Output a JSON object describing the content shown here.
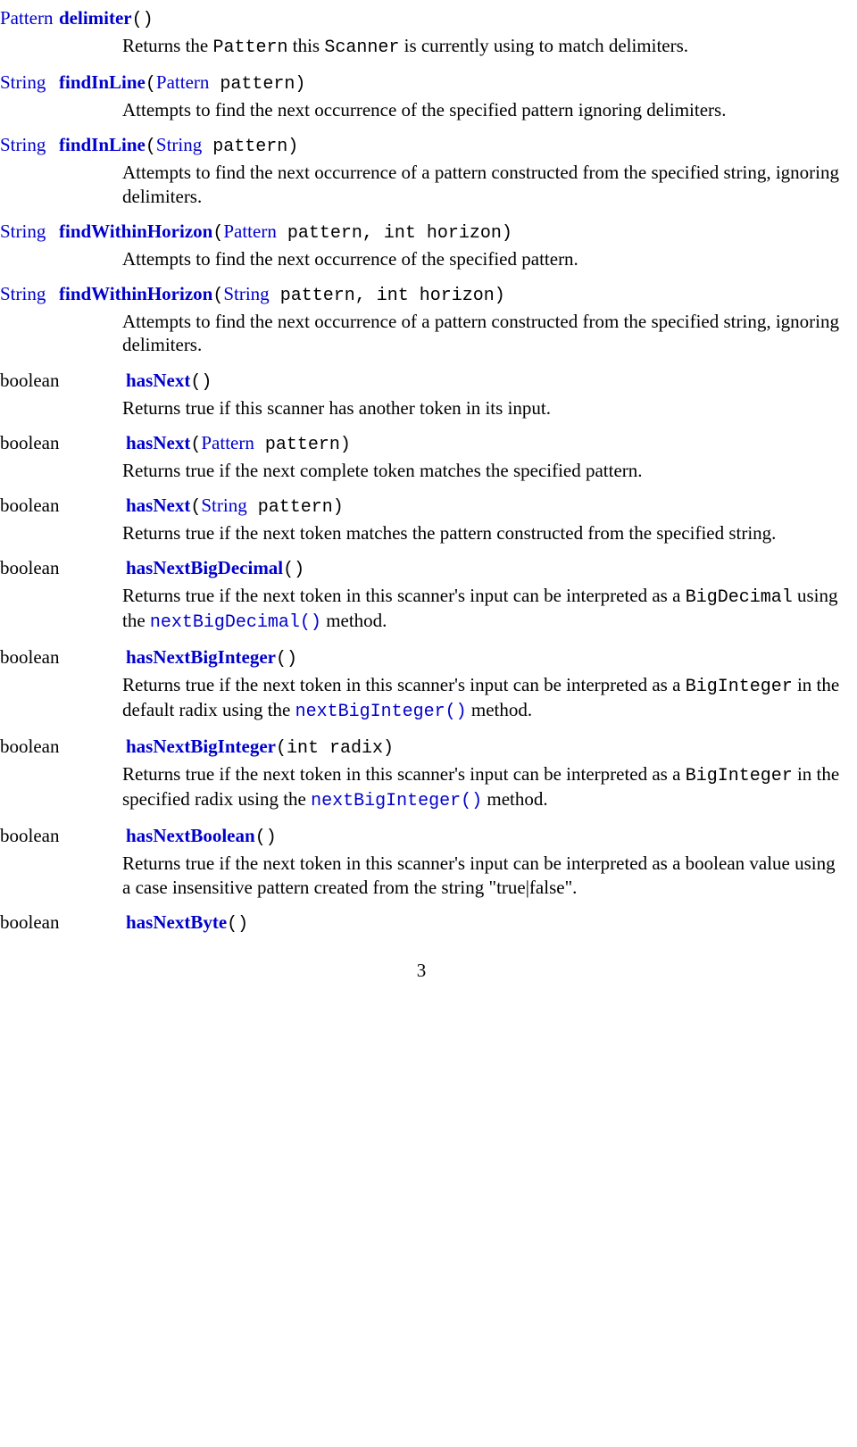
{
  "methods": [
    {
      "ret": "Pattern",
      "retLink": true,
      "retWide": false,
      "name": "delimiter",
      "paramsPlain": "()",
      "desc_pre": "Returns the ",
      "desc_code1": "Pattern",
      "desc_mid1": " this ",
      "desc_code2": "Scanner",
      "desc_post": " is currently using to match delimiters."
    },
    {
      "ret": "String",
      "retLink": true,
      "retWide": false,
      "name": "findInLine",
      "paramsPre": "(",
      "paramLink1": "Pattern",
      "paramsPost": " pattern)",
      "desc_pre": "Attempts to find the next occurrence of the specified pattern ignoring delimiters."
    },
    {
      "ret": "String",
      "retLink": true,
      "retWide": false,
      "name": "findInLine",
      "paramsPre": "(",
      "paramLink1": "String",
      "paramsPost": " pattern)",
      "desc_pre": "Attempts to find the next occurrence of a pattern constructed from the specified string, ignoring delimiters."
    },
    {
      "ret": "String",
      "retLink": true,
      "retWide": false,
      "name": "findWithinHorizon",
      "paramsPre": "(",
      "paramLink1": "Pattern",
      "paramsPost": " pattern, int horizon)",
      "desc_pre": "Attempts to find the next occurrence of the specified pattern."
    },
    {
      "ret": "String",
      "retLink": true,
      "retWide": false,
      "name": "findWithinHorizon",
      "paramsPre": "(",
      "paramLink1": "String",
      "paramsPost": " pattern, int horizon)",
      "desc_pre": "Attempts to find the next occurrence of a pattern constructed from the specified string, ignoring delimiters."
    },
    {
      "ret": "boolean",
      "retLink": false,
      "retWide": true,
      "name": "hasNext",
      "paramsPlain": "()",
      "desc_pre": "Returns true if this scanner has another token in its input."
    },
    {
      "ret": "boolean",
      "retLink": false,
      "retWide": true,
      "name": "hasNext",
      "paramsPre": "(",
      "paramLink1": "Pattern",
      "paramsPost": " pattern)",
      "desc_pre": "Returns true if the next complete token matches the specified pattern."
    },
    {
      "ret": "boolean",
      "retLink": false,
      "retWide": true,
      "name": "hasNext",
      "paramsPre": "(",
      "paramLink1": "String",
      "paramsPost": " pattern)",
      "desc_pre": "Returns true if the next token matches the pattern constructed from the specified string."
    },
    {
      "ret": "boolean",
      "retLink": false,
      "retWide": true,
      "name": "hasNextBigDecimal",
      "paramsPlain": "()",
      "desc_pre": "Returns true if the next token in this scanner's input can be interpreted as a ",
      "desc_code1": "BigDecimal",
      "desc_mid1": " using the ",
      "desc_codeLink1": "nextBigDecimal()",
      "desc_post": " method."
    },
    {
      "ret": "boolean",
      "retLink": false,
      "retWide": true,
      "name": "hasNextBigInteger",
      "paramsPlain": "()",
      "desc_pre": "Returns true if the next token in this scanner's input can be interpreted as a ",
      "desc_code1": "BigInteger",
      "desc_mid1": " in the default radix using the ",
      "desc_codeLink1": "nextBigInteger()",
      "desc_post": " method."
    },
    {
      "ret": "boolean",
      "retLink": false,
      "retWide": true,
      "name": "hasNextBigInteger",
      "paramsPlain": "(int radix)",
      "desc_pre": "Returns true if the next token in this scanner's input can be interpreted as a ",
      "desc_code1": "BigInteger",
      "desc_mid1": " in the specified radix using the ",
      "desc_codeLink1": "nextBigInteger()",
      "desc_post": " method."
    },
    {
      "ret": "boolean",
      "retLink": false,
      "retWide": true,
      "name": "hasNextBoolean",
      "paramsPlain": "()",
      "desc_pre": "Returns true if the next token in this scanner's input can be interpreted as a boolean value using a case insensitive pattern created from the string \"true|false\"."
    },
    {
      "ret": "boolean",
      "retLink": false,
      "retWide": true,
      "name": "hasNextByte",
      "paramsPlain": "()",
      "noDesc": true
    }
  ],
  "pageNumber": "3"
}
